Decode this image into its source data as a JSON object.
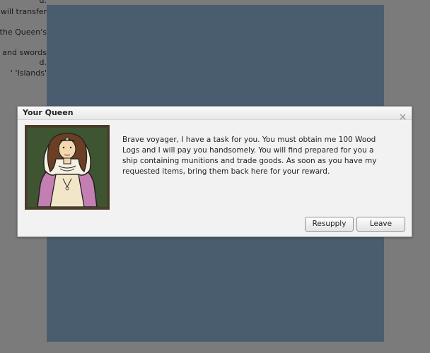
{
  "background": {
    "lines": [
      "d.",
      "will transfer",
      "the Queen's",
      "and swords",
      "d.",
      "' 'Islands'"
    ]
  },
  "dialog": {
    "title": "Your Queen",
    "close_icon": "close-icon",
    "portrait_icon": "queen-portrait",
    "message": "Brave voyager, I have a task for you. You must obtain me 100 Wood Logs and I will pay you handsomely. You will find prepared for you a ship containing munitions and trade goods. As soon as you have my requested items, bring them back here for your reward.",
    "buttons": {
      "resupply": "Resupply",
      "leave": "Leave"
    }
  },
  "colors": {
    "overlay": "#7b7b7b",
    "game_panel": "#4a5d6e",
    "dialog_bg": "#f2f2f2"
  }
}
